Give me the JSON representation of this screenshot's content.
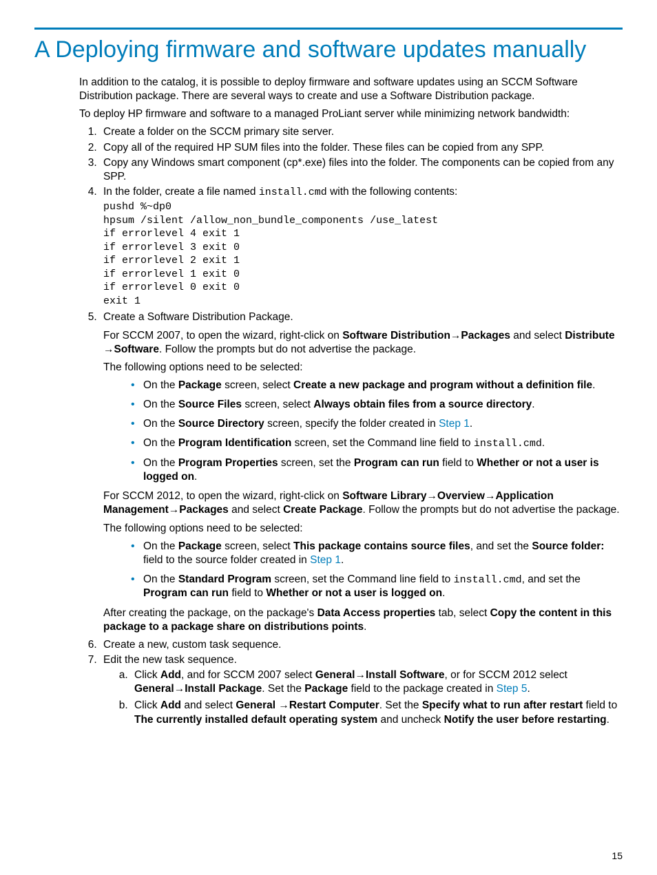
{
  "title": "A Deploying firmware and software updates manually",
  "intro1": "In addition to the catalog, it is possible to deploy firmware and software updates using an SCCM Software Distribution package. There are several ways to create and use a Software Distribution package.",
  "intro2": "To deploy HP firmware and software to a managed ProLiant server while minimizing network bandwidth:",
  "step1": "Create a folder on the SCCM primary site server.",
  "step2": "Copy all of the required HP SUM files into the folder. These files can be copied from any SPP.",
  "step3": "Copy any Windows smart component (cp*.exe) files into the folder. The components can be copied from any SPP.",
  "step4a": "In the folder, create a file named ",
  "step4_fname": "install.cmd",
  "step4b": " with the following contents:",
  "code": "pushd %~dp0\nhpsum /silent /allow_non_bundle_components /use_latest\nif errorlevel 4 exit 1\nif errorlevel 3 exit 0\nif errorlevel 2 exit 1\nif errorlevel 1 exit 0\nif errorlevel 0 exit 0\nexit 1",
  "step5_head": "Create a Software Distribution Package.",
  "s5": {
    "p1a": "For SCCM 2007, to open the wizard, right-click on ",
    "p1b": "Software Distribution",
    "p1c": "Packages",
    "p1d": " and select ",
    "p1e": "Distribute ",
    "p1f": "Software",
    "p1g": ". Follow the prompts but do not advertise the package.",
    "opts_lead": "The following options need to be selected:",
    "b1a": "On the ",
    "b1b": "Package",
    "b1c": " screen, select ",
    "b1d": "Create a new package and program without a definition file",
    "b1e": ".",
    "b2a": "On the ",
    "b2b": "Source Files",
    "b2c": " screen, select ",
    "b2d": "Always obtain files from a source directory",
    "b2e": ".",
    "b3a": "On the ",
    "b3b": "Source Directory",
    "b3c": " screen, specify the folder created in ",
    "b3d": "Step 1",
    "b3e": ".",
    "b4a": "On the ",
    "b4b": "Program Identification",
    "b4c": " screen, set the Command line field to ",
    "b4d": "install.cmd",
    "b4e": ".",
    "b5a": "On the ",
    "b5b": "Program Properties",
    "b5c": " screen, set the ",
    "b5d": "Program can run",
    "b5e": " field to ",
    "b5f": "Whether or not a user is logged on",
    "b5g": ".",
    "p2a": "For SCCM 2012, to open the wizard, right-click on ",
    "p2b": "Software Library",
    "p2c": "Overview",
    "p2d": "Application Management",
    "p2e": "Packages",
    "p2f": " and select ",
    "p2g": "Create Package",
    "p2h": ". Follow the prompts but do not advertise the package.",
    "c1a": "On the ",
    "c1b": "Package",
    "c1c": " screen, select ",
    "c1d": "This package contains source files",
    "c1e": ", and set the ",
    "c1f": "Source folder:",
    "c1g": " field to the source folder created in ",
    "c1h": "Step 1",
    "c1i": ".",
    "c2a": "On the ",
    "c2b": "Standard Program",
    "c2c": " screen, set the Command line field to ",
    "c2d": "install.cmd",
    "c2e": ", and set the ",
    "c2f": "Program can run",
    "c2g": " field to ",
    "c2h": "Whether or not a user is logged on",
    "c2i": ".",
    "after_a": "After creating the package, on the package's ",
    "after_b": "Data Access properties",
    "after_c": " tab, select ",
    "after_d": "Copy the content in this package to a package share on distributions points",
    "after_e": "."
  },
  "step6": "Create a new, custom task sequence.",
  "step7": "Edit the new task sequence.",
  "s7a": {
    "a1": "Click ",
    "a2": "Add",
    "a3": ", and for SCCM 2007 select ",
    "a4": "General",
    "a5": "Install Software",
    "a6": ", or for SCCM 2012 select ",
    "a7": "General",
    "a8": "Install Package",
    "a9": ". Set the ",
    "a10": "Package",
    "a11": " field to the package created in ",
    "a12": "Step 5",
    "a13": "."
  },
  "s7b": {
    "b1": "Click ",
    "b2": "Add",
    "b3": " and select ",
    "b4": "General ",
    "b5": "Restart Computer",
    "b6": ". Set the ",
    "b7": "Specify what to run after restart",
    "b8": " field to ",
    "b9": "The currently installed default operating system",
    "b10": " and uncheck ",
    "b11": "Notify the user before restarting",
    "b12": "."
  },
  "pagenum": "15",
  "arrow": "→"
}
